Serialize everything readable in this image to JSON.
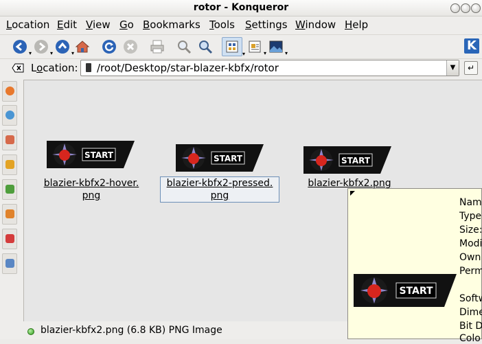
{
  "window": {
    "title": "rotor - Konqueror"
  },
  "menubar": {
    "items": [
      {
        "label": "Location",
        "underline": "L",
        "rest": "ocation"
      },
      {
        "label": "Edit",
        "underline": "E",
        "rest": "dit"
      },
      {
        "label": "View",
        "underline": "V",
        "rest": "iew"
      },
      {
        "label": "Go",
        "underline": "G",
        "rest": "o"
      },
      {
        "label": "Bookmarks",
        "underline": "B",
        "rest": "ookmarks"
      },
      {
        "label": "Tools",
        "underline": "T",
        "rest": "ools"
      },
      {
        "label": "Settings",
        "underline": "S",
        "rest": "ettings"
      },
      {
        "label": "Window",
        "underline": "W",
        "rest": "indow"
      },
      {
        "label": "Help",
        "underline": "H",
        "rest": "elp"
      }
    ]
  },
  "toolbar": {
    "icons": [
      "back-icon",
      "forward-icon",
      "up-icon",
      "home-icon",
      "reload-icon",
      "stop-icon",
      "print-icon",
      "zoom-in-icon",
      "zoom-out-icon",
      "icon-view-icon",
      "info-list-view-icon",
      "image-view-icon",
      "kde-logo-icon"
    ]
  },
  "location": {
    "label_u": "o",
    "label_pre": "L",
    "label_post": "cation:",
    "value": "/root/Desktop/star-blazer-kbfx/rotor"
  },
  "files": [
    {
      "name_line1": "blazier-kbfx2-hover.",
      "name_line2": "png",
      "selected": false,
      "button_text": "START"
    },
    {
      "name_line1": "blazier-kbfx2-pressed.",
      "name_line2": "png",
      "selected": true,
      "button_text": "START"
    },
    {
      "name_line1": "blazier-kbfx2.png",
      "name_line2": "",
      "selected": false,
      "button_text": "START"
    }
  ],
  "tooltip": {
    "rows": [
      "Nam",
      "Type",
      "Size:",
      "Modi",
      "Own",
      "Perm",
      "",
      "Softw",
      "Dime",
      "Bit D",
      "Colo"
    ],
    "button_text": "START"
  },
  "status": {
    "text": "blazier-kbfx2.png (6.8 KB)  PNG Image"
  },
  "colors": {
    "view_bg": "#e6e6e6",
    "tooltip_bg": "#ffffe1",
    "selection_border": "#6c8fb7",
    "kde_blue": "#2a66b8"
  }
}
